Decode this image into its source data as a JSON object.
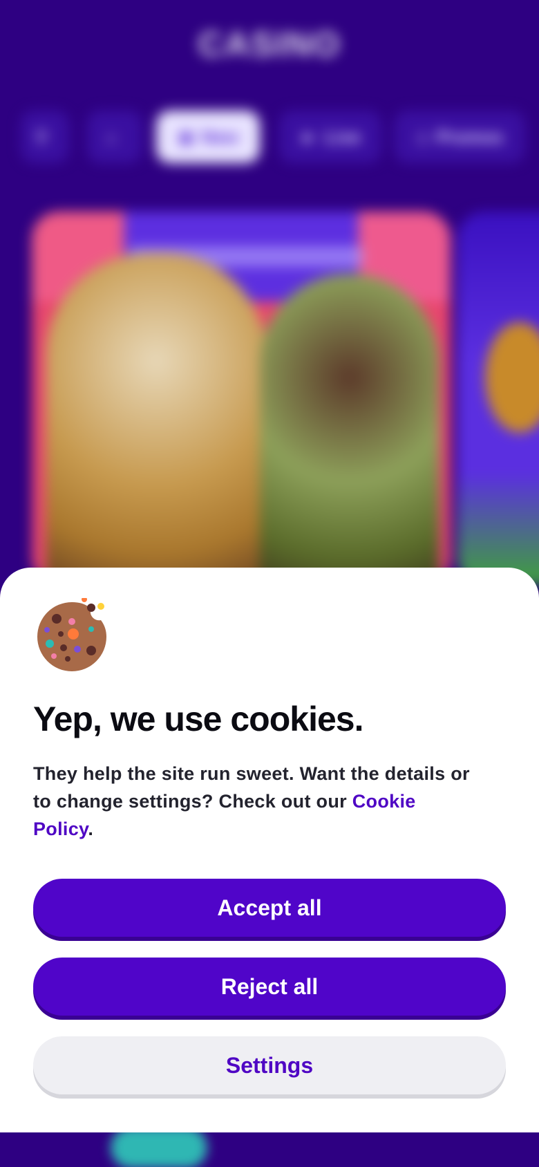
{
  "background": {
    "logo_text": "CASINO",
    "nav": [
      {
        "label": "",
        "icon": "search-icon"
      },
      {
        "label": "",
        "icon": "home-icon"
      },
      {
        "label": "New",
        "icon": "new-icon"
      },
      {
        "label": "Live",
        "icon": "live-camera-icon"
      },
      {
        "label": "Promos",
        "icon": "gift-icon"
      }
    ]
  },
  "cookie_banner": {
    "icon": "cookie-icon",
    "title": "Yep, we use cookies.",
    "description_text": "They help the site run sweet. Want the details or to change settings? Check out our",
    "policy_link": "Cookie Policy",
    "period": ".",
    "buttons": {
      "accept": "Accept all",
      "reject": "Reject all",
      "settings": "Settings"
    }
  },
  "colors": {
    "brand_purple": "#5005c9",
    "background_purple": "#2e0082",
    "sheet_white": "#ffffff",
    "secondary_button": "#efeff3"
  }
}
